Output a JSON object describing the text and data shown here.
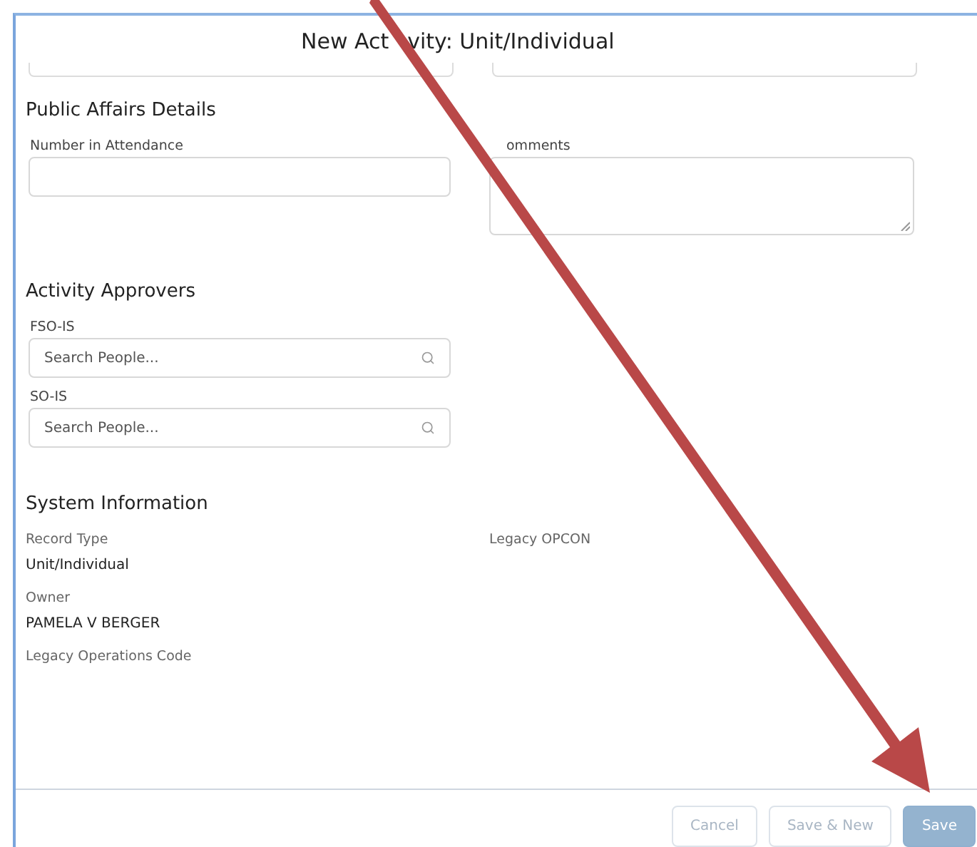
{
  "window": {
    "title_segments": [
      "New Act",
      "vity: Unit/Individual"
    ]
  },
  "partial_fields": [
    {
      "kind": "input"
    },
    {
      "kind": "input"
    }
  ],
  "sections": [
    {
      "heading": "Public Affairs Details",
      "rows": [
        [
          {
            "kind": "input",
            "label": "Number in Attendance"
          },
          {
            "kind": "textarea",
            "label": "omments"
          }
        ]
      ]
    },
    {
      "heading": "Activity Approvers",
      "rows": [
        [
          {
            "kind": "search",
            "label": "FSO-IS",
            "placeholder": "Search People..."
          }
        ],
        [
          {
            "kind": "search",
            "label": "SO-IS",
            "placeholder": "Search People..."
          }
        ]
      ]
    },
    {
      "heading": "System Information",
      "rows": [
        [
          {
            "kind": "readonly",
            "label": "Record Type",
            "value": "Unit/Individual"
          },
          {
            "kind": "readonly",
            "label": "Legacy OPCON"
          }
        ],
        [
          {
            "kind": "readonly",
            "label": "Owner",
            "value": "PAMELA V BERGER"
          }
        ],
        [
          {
            "kind": "readonly",
            "label": "Legacy Operations Code"
          }
        ]
      ]
    }
  ],
  "buttons": [
    {
      "label": "Cancel",
      "kind": "neutral",
      "disabled": true
    },
    {
      "label": "Save & New",
      "kind": "neutral",
      "disabled": true
    },
    {
      "label": "Save",
      "kind": "brand",
      "disabled": true
    }
  ]
}
